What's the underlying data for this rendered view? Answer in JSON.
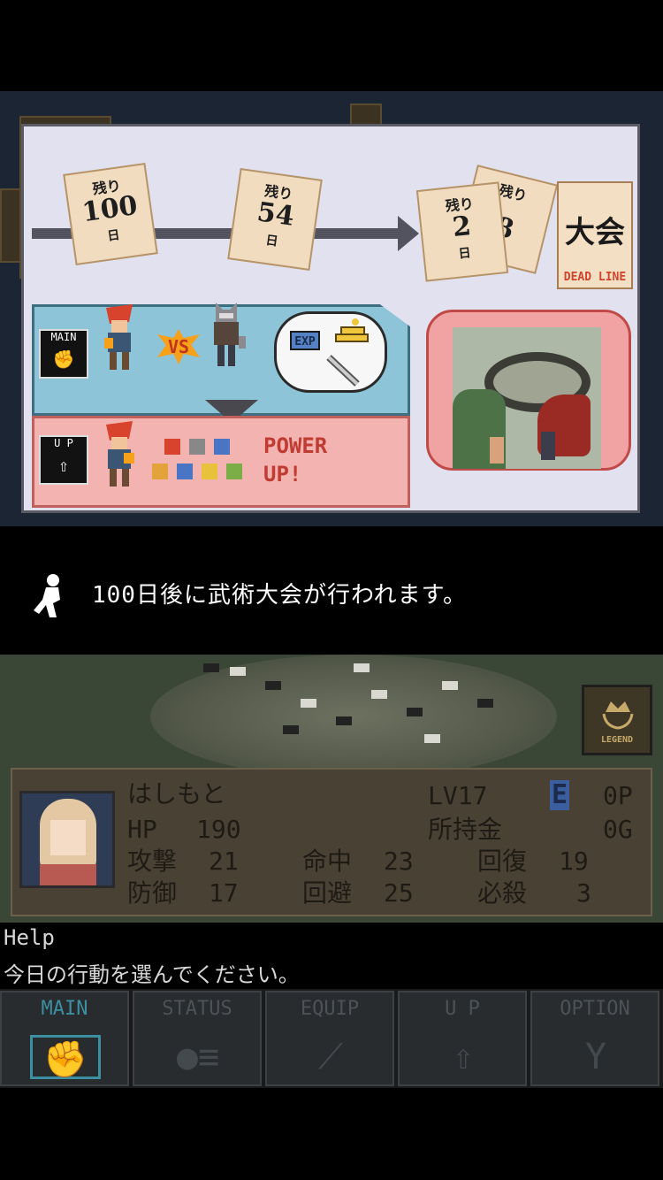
{
  "tutorial": {
    "papers": [
      {
        "top": "残り",
        "num": "100",
        "day": "日"
      },
      {
        "top": "残り",
        "num": "54",
        "day": "日"
      },
      {
        "top": "残り",
        "num": "2",
        "day": "日"
      },
      {
        "top": "残り",
        "num": "8",
        "day": "日"
      }
    ],
    "deadline": {
      "title": "大会",
      "label": "DEAD LINE"
    },
    "main_tag": "MAIN",
    "up_tag": "U P",
    "vs": "VS",
    "exp": "EXP",
    "power_up_line1": "POWER",
    "power_up_line2": "UP!",
    "stat_icons": [
      "HP",
      "STR",
      "DEF",
      "DEX",
      "EVD",
      "HEL",
      "LUK"
    ]
  },
  "message": {
    "text": "100日後に武術大会が行われます。",
    "icon": "running-person-icon"
  },
  "legend_badge": {
    "label": "LEGEND"
  },
  "status": {
    "name": "はしもと",
    "level_label": "LV17",
    "grade": "E",
    "points": "0P",
    "hp_label": "HP",
    "hp_value": "190",
    "money_label": "所持金",
    "money_value": "0G",
    "atk_label": "攻撃",
    "atk_value": "21",
    "hit_label": "命中",
    "hit_value": "23",
    "heal_label": "回復",
    "heal_value": "19",
    "def_label": "防御",
    "def_value": "17",
    "evd_label": "回避",
    "evd_value": "25",
    "crit_label": "必殺",
    "crit_value": "3"
  },
  "help": {
    "title": "Help",
    "text": "今日の行動を選んでください。"
  },
  "tabs": [
    {
      "label": "MAIN",
      "icon": "glove-icon",
      "active": true
    },
    {
      "label": "STATUS",
      "icon": "person-stats-icon",
      "active": false
    },
    {
      "label": "EQUIP",
      "icon": "sword-icon",
      "active": false
    },
    {
      "label": "U P",
      "icon": "up-arrow-icon",
      "active": false
    },
    {
      "label": "OPTION",
      "icon": "wrench-icon",
      "active": false
    }
  ],
  "colors": {
    "active_tab": "#3b8fa0",
    "inactive_tab": "#4d5256",
    "power_up": "#c03b32",
    "deadline_label": "#d2432b"
  }
}
